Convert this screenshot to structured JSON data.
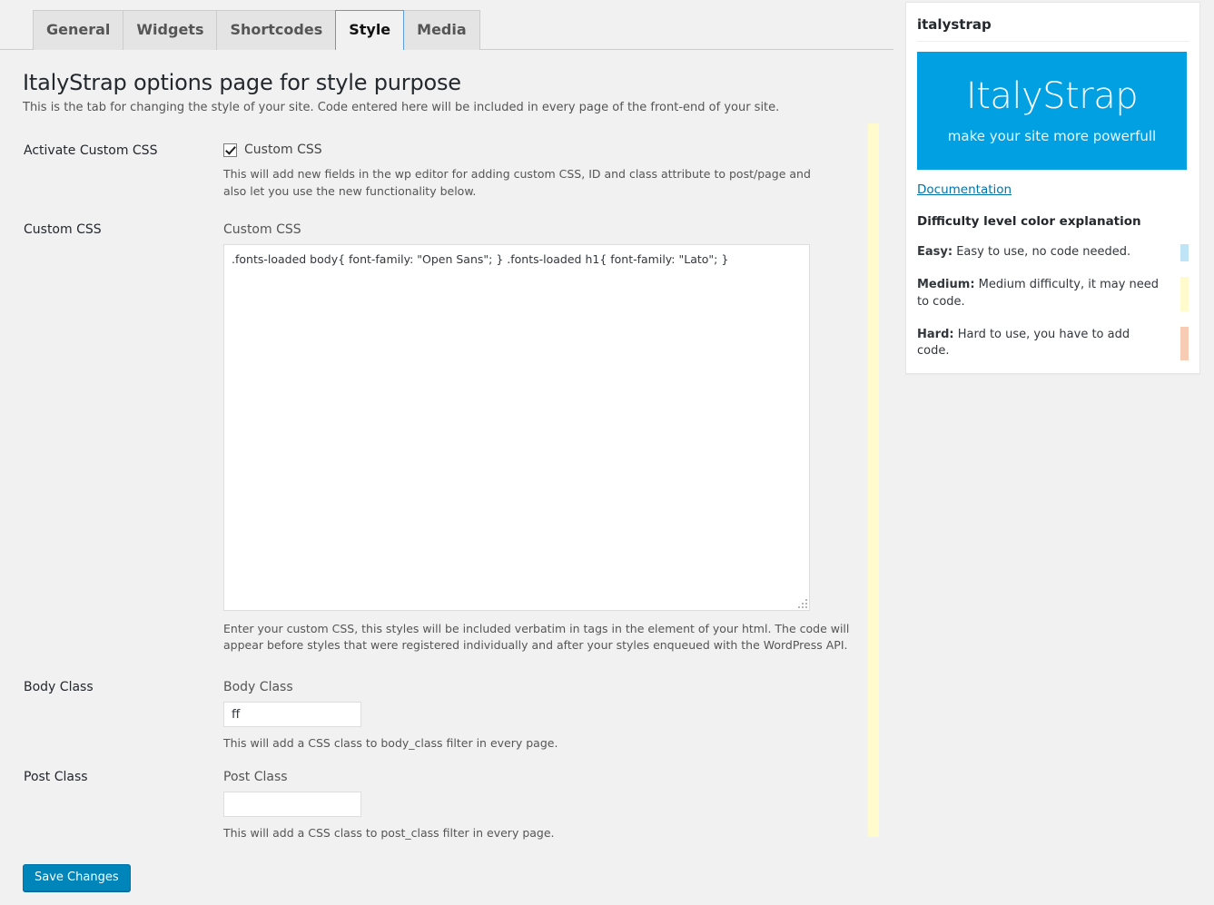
{
  "tabs": [
    {
      "label": "General",
      "active": false
    },
    {
      "label": "Widgets",
      "active": false
    },
    {
      "label": "Shortcodes",
      "active": false
    },
    {
      "label": "Style",
      "active": true
    },
    {
      "label": "Media",
      "active": false
    }
  ],
  "page": {
    "title": "ItalyStrap options page for style purpose",
    "description": "This is the tab for changing the style of your site. Code entered here will be included in every page of the front-end of your site."
  },
  "fields": {
    "activate_custom_css": {
      "row_label": "Activate Custom CSS",
      "checkbox_label": "Custom CSS",
      "checked": true,
      "description": "This will add new fields in the wp editor for adding custom CSS, ID and class attribute to post/page and also let you use the new functionality below."
    },
    "custom_css": {
      "row_label": "Custom CSS",
      "field_label": "Custom CSS",
      "value": ".fonts-loaded body{ font-family: \"Open Sans\"; } .fonts-loaded h1{ font-family: \"Lato\"; }",
      "placeholder": "",
      "description": "Enter your custom CSS, this styles will be included verbatim in tags in the element of your html. The code will appear before styles that were registered individually and after your styles enqueued with the WordPress API."
    },
    "body_class": {
      "row_label": "Body Class",
      "field_label": "Body Class",
      "value": "ff",
      "placeholder": "",
      "description": "This will add a CSS class to body_class filter in every page."
    },
    "post_class": {
      "row_label": "Post Class",
      "field_label": "Post Class",
      "value": "",
      "placeholder": "",
      "description": "This will add a CSS class to post_class filter in every page."
    }
  },
  "submit": {
    "label": "Save Changes"
  },
  "sidebar": {
    "title": "italystrap",
    "banner": {
      "title": "ItalyStrap",
      "subtitle": "make your site more powerfull",
      "color": "#00a0e3"
    },
    "documentation_link": "Documentation",
    "difficulty": {
      "heading": "Difficulty level color explanation",
      "items": [
        {
          "name": "Easy:",
          "text": " Easy to use, no code needed.",
          "color": "#bfe3f7"
        },
        {
          "name": "Medium:",
          "text": " Medium difficulty, it may need to code.",
          "color": "#fffbcc"
        },
        {
          "name": "Hard:",
          "text": " Hard to use, you have to add code.",
          "color": "#f8cbb4"
        }
      ]
    }
  },
  "difficulty_stripe": {
    "color": "#fffbcc"
  }
}
